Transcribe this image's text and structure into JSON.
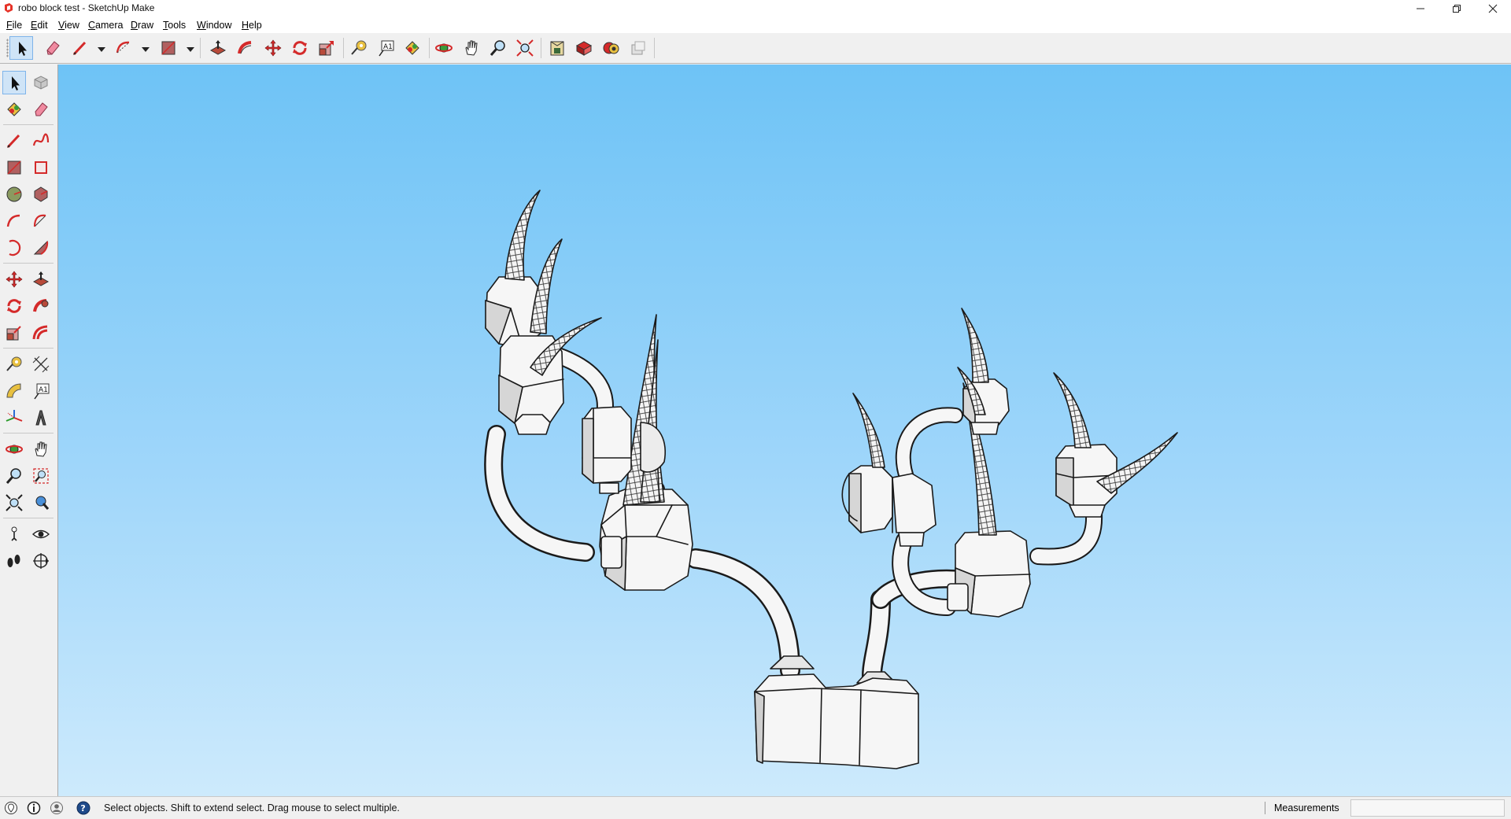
{
  "window": {
    "title": "robo block test - SketchUp Make",
    "controls": [
      "minimize-icon",
      "restore-icon",
      "close-icon"
    ]
  },
  "menu": [
    {
      "mn": "F",
      "rest": "ile"
    },
    {
      "mn": "E",
      "rest": "dit"
    },
    {
      "mn": "V",
      "rest": "iew"
    },
    {
      "mn": "C",
      "rest": "amera"
    },
    {
      "mn": "D",
      "rest": "raw"
    },
    {
      "mn": "T",
      "rest": "ools"
    },
    {
      "mn": "W",
      "rest": "indow"
    },
    {
      "mn": "H",
      "rest": "elp"
    }
  ],
  "toolbar": {
    "active_tool": "select",
    "tools": [
      "select-arrow-icon",
      "eraser-icon",
      "pencil-line-icon",
      "arc-icon",
      "rectangle-icon",
      "push-pull-icon",
      "follow-me-icon",
      "move-icon",
      "rotate-icon",
      "scale-icon",
      "tape-measure-icon",
      "text-icon",
      "paint-bucket-icon",
      "orbit-icon",
      "pan-icon",
      "zoom-icon",
      "zoom-extents-icon",
      "3d-warehouse-icon",
      "extension-warehouse-icon",
      "layout-icon",
      "extension-manager-icon"
    ]
  },
  "left_toolbar": {
    "tools": [
      "select-icon",
      "make-component-icon",
      "paint-bucket-icon",
      "eraser-icon",
      "line-icon",
      "freehand-icon",
      "rectangle-icon",
      "rotated-rectangle-icon",
      "circle-icon",
      "polygon-icon",
      "arc-icon",
      "two-point-arc-icon",
      "three-point-arc-icon",
      "pie-icon",
      "move-icon",
      "push-pull-icon",
      "rotate-icon",
      "follow-me-icon",
      "scale-icon",
      "offset-icon",
      "tape-measure-icon",
      "dimension-icon",
      "protractor-icon",
      "text-icon",
      "axes-icon",
      "3d-text-icon",
      "orbit-icon",
      "pan-icon",
      "zoom-icon",
      "zoom-window-icon",
      "zoom-extents-icon",
      "previous-view-icon",
      "position-camera-icon",
      "look-around-icon",
      "walk-icon",
      "section-plane-icon"
    ]
  },
  "colors": {
    "sky_top": "#6ec3f6",
    "sky_bottom": "#cdeafc",
    "tool_red": "#d42a2a",
    "active_tool_bg": "#cfe4f7"
  },
  "status": {
    "hint": "Select objects. Shift to extend select. Drag mouse to select multiple.",
    "measurements_label": "Measurements",
    "measurements_value": ""
  }
}
